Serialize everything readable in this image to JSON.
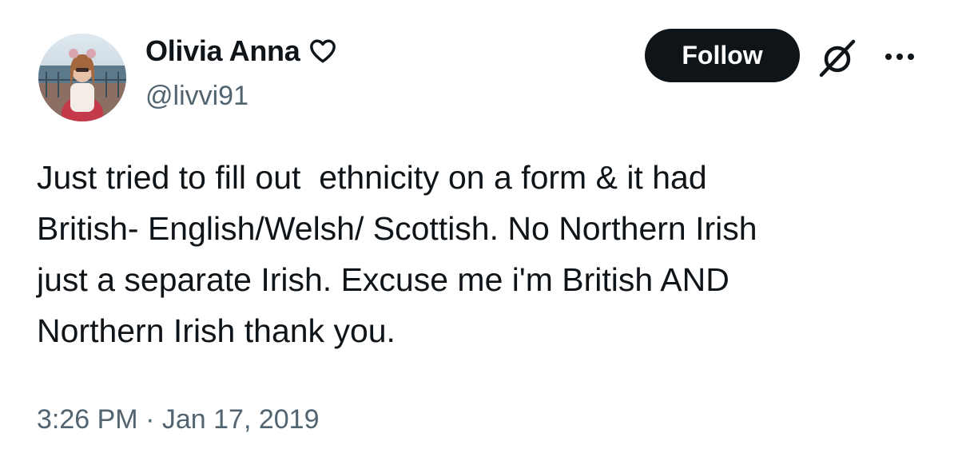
{
  "author": {
    "display_name": "Olivia Anna",
    "handle": "@livvi91"
  },
  "actions": {
    "follow_label": "Follow"
  },
  "icons": {
    "heart": "heart-outline-icon",
    "grok": "grok-icon",
    "more": "more-icon"
  },
  "tweet": {
    "text": "Just tried to fill out  ethnicity on a form & it had\nBritish- English/Welsh/ Scottish. No Northern Irish\njust a separate Irish. Excuse me i'm British AND\nNorthern Irish thank you.",
    "time": "3:26 PM",
    "separator": "·",
    "date": "Jan 17, 2019"
  },
  "colors": {
    "text": "#0f1419",
    "secondary": "#536471",
    "button_bg": "#0f1419",
    "button_text": "#ffffff"
  }
}
